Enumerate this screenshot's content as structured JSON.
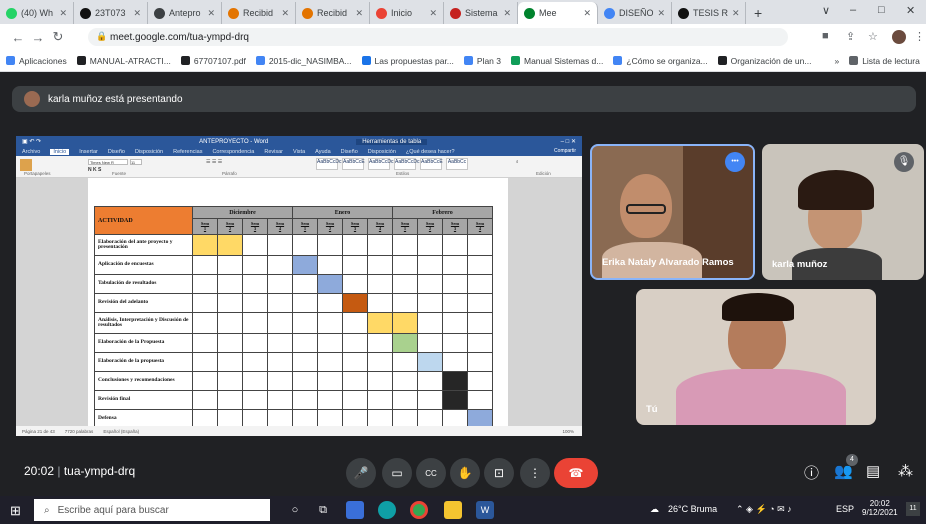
{
  "browser": {
    "tabs": [
      {
        "label": "(40) Wh",
        "color": "#25d366"
      },
      {
        "label": "23T073",
        "color": "#111111"
      },
      {
        "label": "Antepro",
        "color": "#3c4043"
      },
      {
        "label": "Recibid",
        "color": "#e37400"
      },
      {
        "label": "Recibid",
        "color": "#e37400"
      },
      {
        "label": "Inicio",
        "color": "#ea4335"
      },
      {
        "label": "Sistema",
        "color": "#c5221f"
      },
      {
        "label": "Mee",
        "color": "#00832d",
        "active": true
      },
      {
        "label": "DISEÑO",
        "color": "#4285f4"
      },
      {
        "label": "TESIS R",
        "color": "#111111"
      }
    ],
    "new_tab": "+",
    "window_controls": [
      "∨",
      "–",
      "□",
      "✕"
    ],
    "url": "meet.google.com/tua-ympd-drq",
    "bookmarks": [
      {
        "label": "Aplicaciones",
        "color": "#4285f4"
      },
      {
        "label": "MANUAL-ATRACTI...",
        "color": "#202124"
      },
      {
        "label": "67707107.pdf",
        "color": "#202124"
      },
      {
        "label": "2015-dic_NASIMBA...",
        "color": "#4285f4"
      },
      {
        "label": "Las propuestas par...",
        "color": "#1a73e8"
      },
      {
        "label": "Plan 3",
        "color": "#4285f4"
      },
      {
        "label": "Manual Sistemas d...",
        "color": "#0f9d58"
      },
      {
        "label": "¿Cómo se organiza...",
        "color": "#4285f4"
      },
      {
        "label": "Organización de un...",
        "color": "#202124"
      },
      {
        "label": "»",
        "color": "#ffffff"
      },
      {
        "label": "Lista de lectura",
        "color": "#5f6368"
      }
    ]
  },
  "meet": {
    "presenting_banner": "karla muñoz está presentando",
    "time": "20:02",
    "separator": "|",
    "meeting_code": "tua-ympd-drq",
    "participants": [
      {
        "name": "Erika Nataly Alvarado Ramos"
      },
      {
        "name": "karla muñoz"
      },
      {
        "name": "Tú"
      }
    ],
    "more_options": "•••",
    "participants_badge": "4"
  },
  "word": {
    "title": "ANTEPROYECTO - Word",
    "tools_label": "Herramientas de tabla",
    "tabs": [
      "Archivo",
      "Inicio",
      "Insertar",
      "Diseño",
      "Disposición",
      "Referencias",
      "Correspondencia",
      "Revisar",
      "Vista",
      "Ayuda",
      "Diseño",
      "Disposición",
      "¿Qué desea hacer?"
    ],
    "share": "Compartir",
    "font_name": "Times New R",
    "font_size": "11",
    "styles": [
      "AaBbCcDc",
      "AaBbCcE",
      "AaBbCcDc",
      "AaBbCcDc",
      "AaBbCcE",
      "AaBbCc"
    ],
    "style_names": [
      "¶ Normal",
      "¶ Sin espa...",
      "Título 1",
      "Título 2",
      "Título",
      "Subtítulo"
    ],
    "groups": [
      "Portapapeles",
      "Fuente",
      "Párrafo",
      "Estilos",
      "Edición"
    ],
    "status": [
      "Página 21 de 43",
      "7720 palabras",
      "Español (España)"
    ],
    "zoom": "100%"
  },
  "table": {
    "header": "ACTIVIDAD",
    "months": [
      "Diciembre",
      "Enero",
      "Febrero"
    ],
    "week_label": "Sem",
    "weeks": [
      "1",
      "2",
      "3",
      "4"
    ],
    "rows": [
      {
        "label": "Elaboración del ante proyecto y presentación",
        "cells": [
          1,
          2
        ],
        "color": "#ffd966"
      },
      {
        "label": "Aplicación de encuestas",
        "cells": [
          5
        ],
        "color": "#8eaadb"
      },
      {
        "label": "Tabulación de resultados",
        "cells": [
          6
        ],
        "color": "#8eaadb"
      },
      {
        "label": "Revisión del adelanto",
        "cells": [
          7
        ],
        "color": "#c55a11"
      },
      {
        "label": "Análisis, Interpretación y Discusión de resultados",
        "cells": [
          8,
          9
        ],
        "color": "#ffd966"
      },
      {
        "label": "Elaboración de la Propuesta",
        "cells": [
          9
        ],
        "color": "#a9d18e"
      },
      {
        "label": "Elaboración de la propuesta",
        "cells": [
          10
        ],
        "color": "#bdd7ee"
      },
      {
        "label": "Conclusiones y recomendaciones",
        "cells": [
          11
        ],
        "color": "#262626"
      },
      {
        "label": "Revisión final",
        "cells": [
          11
        ],
        "color": "#262626"
      },
      {
        "label": "Defensa",
        "cells": [
          12
        ],
        "color": "#8eaadb"
      }
    ]
  },
  "taskbar": {
    "search_placeholder": "Escribe aquí para buscar",
    "weather": "26°C Bruma",
    "lang": "ESP",
    "clock_time": "20:02",
    "clock_date": "9/12/2021",
    "notif_count": "11"
  }
}
